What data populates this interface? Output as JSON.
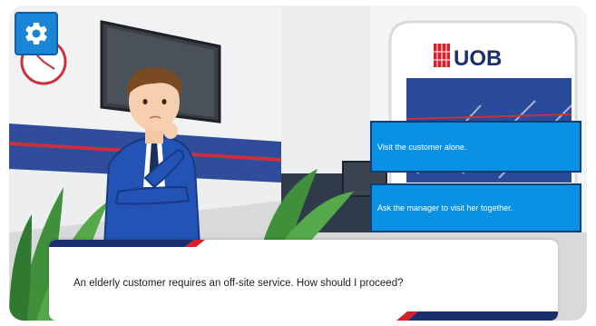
{
  "settings": {
    "icon": "gear-icon"
  },
  "scene": {
    "bank_logo_text": "UOB"
  },
  "choices": [
    {
      "label": "Visit the customer alone."
    },
    {
      "label": "Ask the manager to visit her together."
    }
  ],
  "dialog": {
    "text": "An elderly customer requires an off-site service. How should I proceed?"
  },
  "colors": {
    "accent": "#0a91e3",
    "brand_red": "#d6202a",
    "brand_navy": "#1b2f6e"
  }
}
